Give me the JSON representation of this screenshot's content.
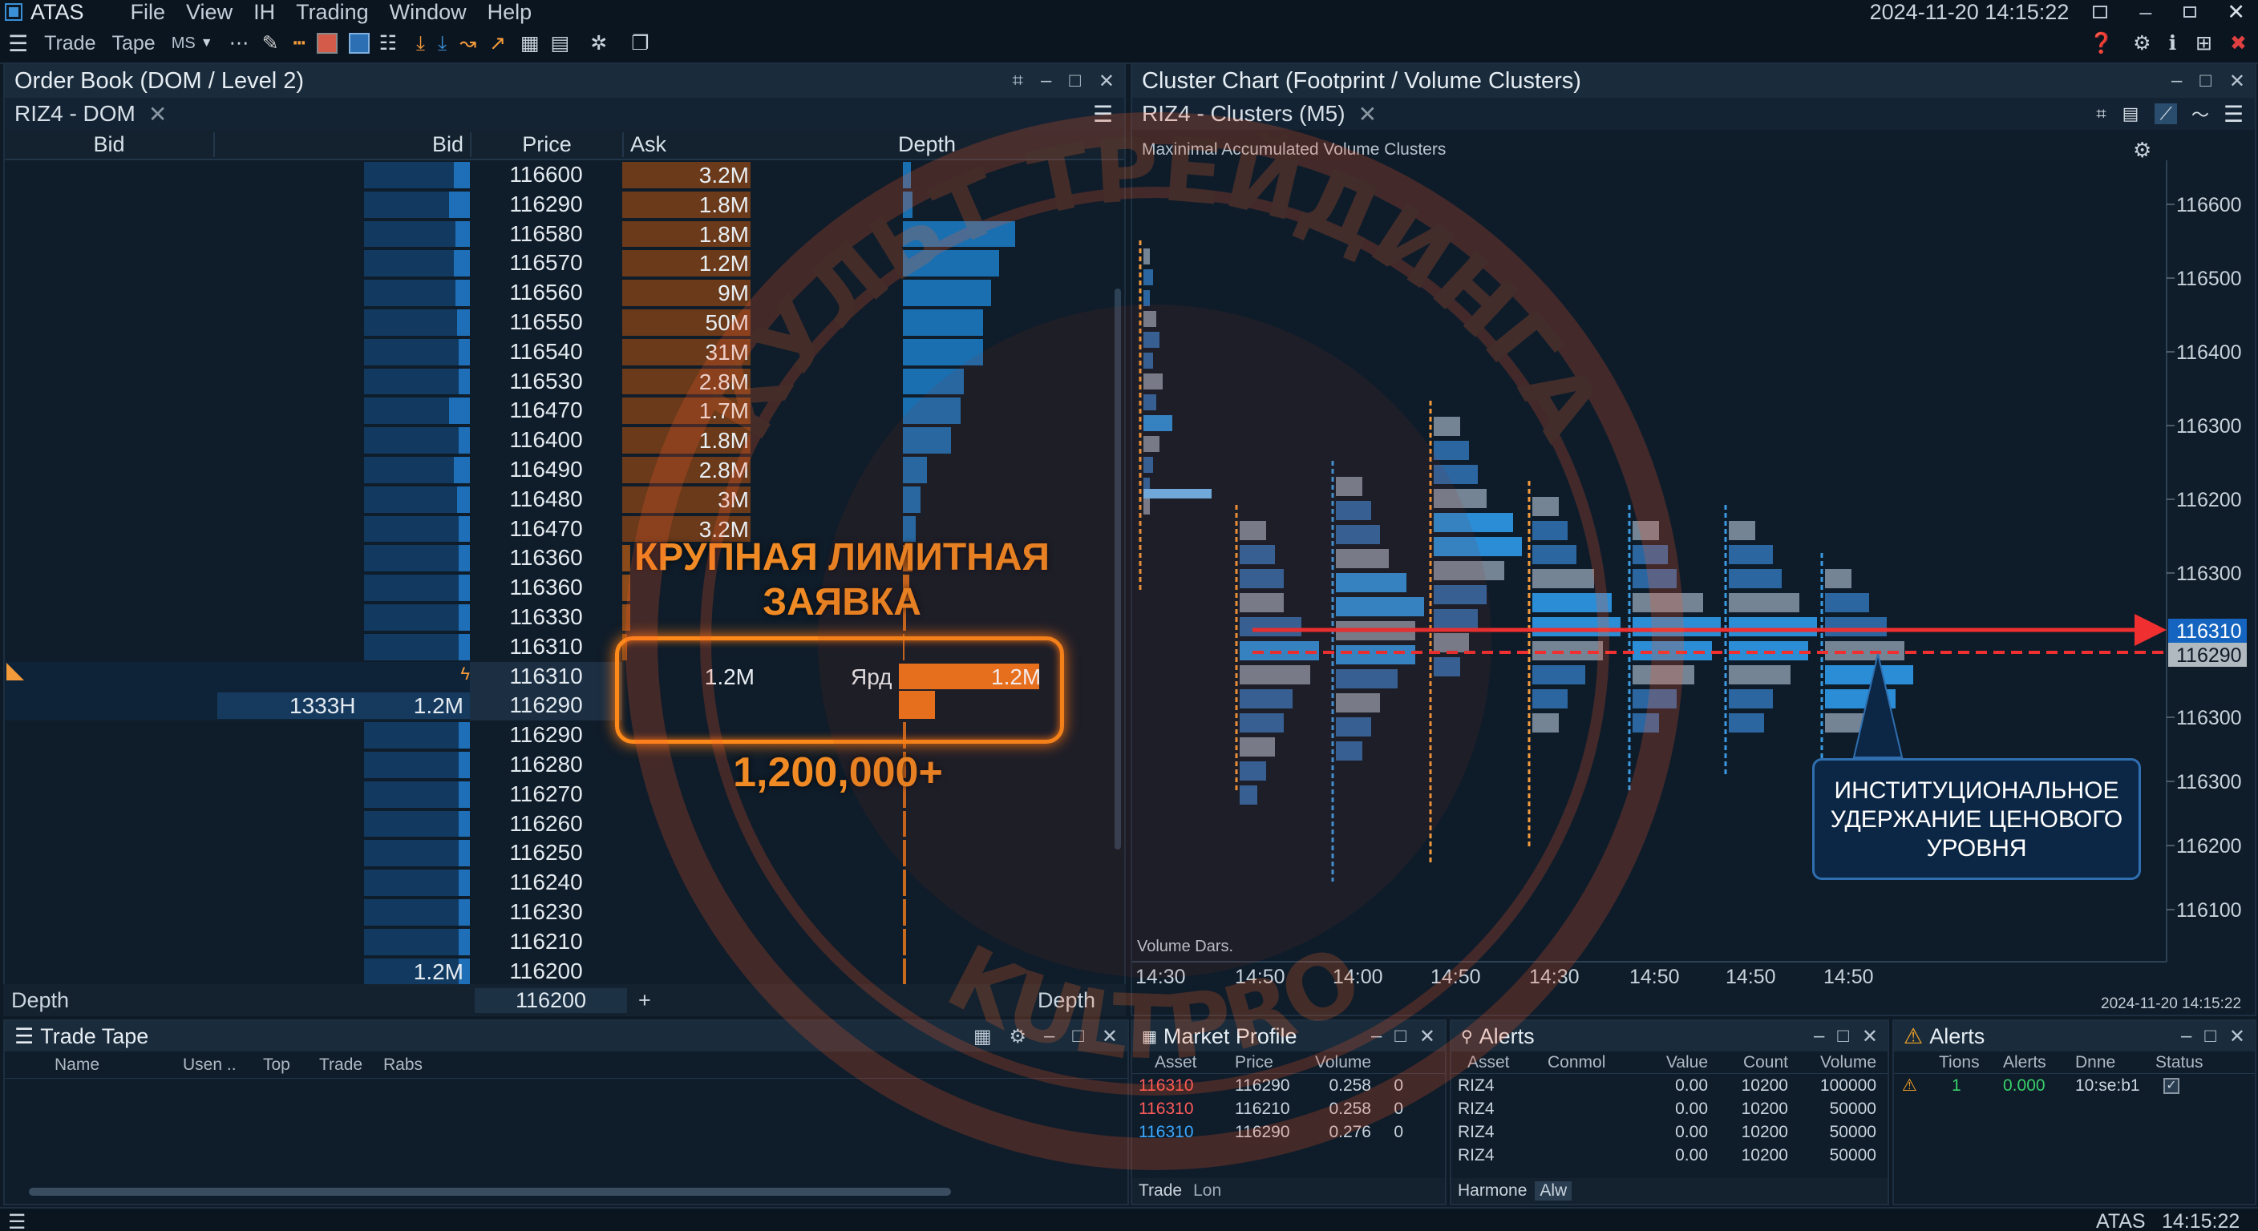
{
  "app": {
    "name": "ATAS",
    "datetime": "2024-11-20 14:15:22"
  },
  "menu": [
    "File",
    "View",
    "IH",
    "Trading",
    "Window",
    "Help"
  ],
  "toolbar": {
    "trade": "Trade",
    "tape": "Tape",
    "ms": "MS"
  },
  "dom": {
    "title": "Order Book (DOM / Level 2)",
    "tab": "RIZ4 - DOM",
    "headers": {
      "bid": "Bid",
      "bid2": "Bid",
      "price": "Price",
      "ask": "Ask",
      "depth": "Depth"
    },
    "rows": [
      {
        "price": "116600",
        "ask": "3.2M"
      },
      {
        "price": "116290",
        "ask": "1.8M"
      },
      {
        "price": "116580",
        "ask": "1.8M"
      },
      {
        "price": "116570",
        "ask": "1.2M"
      },
      {
        "price": "116560",
        "ask": "9M"
      },
      {
        "price": "116550",
        "ask": "50M"
      },
      {
        "price": "116540",
        "ask": "31M"
      },
      {
        "price": "116530",
        "ask": "2.8M"
      },
      {
        "price": "116470",
        "ask": "1.7M"
      },
      {
        "price": "116400",
        "ask": "1.8M"
      },
      {
        "price": "116490",
        "ask": "2.8M"
      },
      {
        "price": "116480",
        "ask": "3M"
      },
      {
        "price": "116470",
        "ask": "3.2M"
      },
      {
        "price": "116360",
        "ask": ""
      },
      {
        "price": "116360",
        "ask": ""
      },
      {
        "price": "116330",
        "ask": ""
      },
      {
        "price": "116310",
        "ask": ""
      },
      {
        "price": "116310",
        "ask": "1.2M",
        "label": "Ярд",
        "depth_val": "1.2M"
      },
      {
        "price": "116290",
        "bid_count": "1333H",
        "bid": "1.2M"
      },
      {
        "price": "116290"
      },
      {
        "price": "116280"
      },
      {
        "price": "116270"
      },
      {
        "price": "116260"
      },
      {
        "price": "116250"
      },
      {
        "price": "116240"
      },
      {
        "price": "116230"
      },
      {
        "price": "116210"
      },
      {
        "price": "116200",
        "bid": "1.2M"
      }
    ],
    "footer": {
      "left": "Depth",
      "price": "116200",
      "plus": "+",
      "right": "Depth"
    }
  },
  "annotations": {
    "big_order_title": "КРУПНАЯ ЛИМИТНАЯ ЗАЯВКА",
    "big_order_line1": "КРУПНАЯ ЛИМИТНАЯ",
    "big_order_line2": "ЗАЯВКА",
    "big_order_amount": "1,200,000+",
    "institutional_line1": "ИНСТИТУЦИОНАЛЬНОЕ",
    "institutional_line2": "УДЕРЖАНИЕ ЦЕНОВОГО",
    "institutional_line3": "УРОВНЯ"
  },
  "cluster": {
    "title": "Cluster Chart (Footprint / Volume Clusters)",
    "tab": "RIZ4 - Clusters (M5)",
    "subtitle": "Maxinimal Accumulated Volume Clusters",
    "y_ticks": [
      "116600",
      "116500",
      "116400",
      "116300",
      "116200",
      "116300",
      "116310",
      "116290",
      "116300",
      "116300",
      "116200",
      "116100"
    ],
    "price_tag_blue": "116310",
    "price_tag_grey": "116290",
    "x_ticks": [
      "14:30",
      "14:50",
      "14:00",
      "14:50",
      "14:30",
      "14:50",
      "14:50",
      "14:50"
    ],
    "volume_label": "Volume Dars.",
    "footer_time": "2024-11-20 14:15:22"
  },
  "trade_tape": {
    "title": "Trade Tape",
    "cols": [
      "Name",
      "Usen ..",
      "Top",
      "Trade",
      "Rabs"
    ]
  },
  "market_profile": {
    "title": "Market Profile",
    "cols": [
      "Asset",
      "Price",
      "Volume"
    ],
    "rows": [
      {
        "asset": "116310",
        "color": "#ff5a5a",
        "price": "116290",
        "vol": "0.258",
        "n": "0"
      },
      {
        "asset": "116310",
        "color": "#ff5a5a",
        "price": "116210",
        "vol": "0.258",
        "n": "0"
      },
      {
        "asset": "116310",
        "color": "#3aa8ff",
        "price": "116290",
        "vol": "0.276",
        "n": "0"
      }
    ],
    "footer": [
      "Trade",
      "Lon"
    ]
  },
  "alerts1": {
    "title": "Alerts",
    "cols": [
      "Asset",
      "Conmol",
      "Value",
      "Count",
      "Volume"
    ],
    "rows": [
      {
        "asset": "RIZ4",
        "value": "0.00",
        "count": "10200",
        "volume": "100000"
      },
      {
        "asset": "RIZ4",
        "value": "0.00",
        "count": "10200",
        "volume": "50000"
      },
      {
        "asset": "RIZ4",
        "value": "0.00",
        "count": "10200",
        "volume": "50000"
      },
      {
        "asset": "RIZ4",
        "value": "0.00",
        "count": "10200",
        "volume": "50000"
      }
    ],
    "footer": [
      "Harmone",
      "Alw"
    ]
  },
  "alerts2": {
    "title": "Alerts",
    "cols": [
      "Tions",
      "Alerts",
      "Dnne",
      "Status"
    ],
    "row": {
      "tions": "1",
      "alerts": "0.000",
      "dnne": "10:se:b1"
    }
  },
  "status": {
    "app": "ATAS",
    "time": "14:15:22"
  },
  "watermark": {
    "top": "КУЛЬТ ТРЕЙДИНГА",
    "bottom": "KULTPRO"
  }
}
